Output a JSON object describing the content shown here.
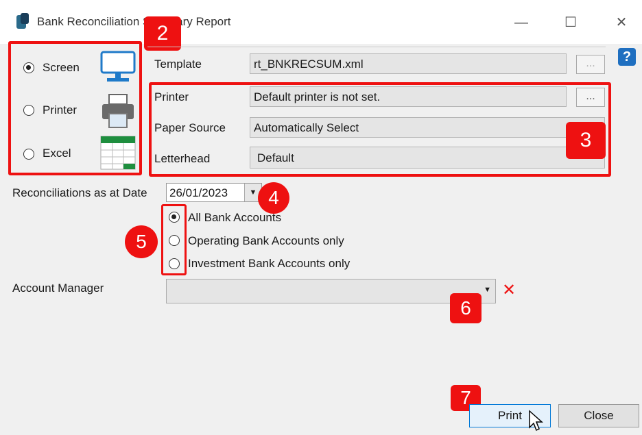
{
  "window": {
    "title": "Bank Reconciliation Summary Report",
    "minimize": "—",
    "maximize": "☐",
    "close": "✕"
  },
  "output": {
    "options": [
      "Screen",
      "Printer",
      "Excel"
    ],
    "selected": "Screen"
  },
  "settings": {
    "template_label": "Template",
    "template_value": "rt_BNKRECSUM.xml",
    "printer_label": "Printer",
    "printer_value": "Default printer is not set.",
    "paper_label": "Paper Source",
    "paper_value": "Automatically Select",
    "letterhead_label": "Letterhead",
    "letterhead_value": "Default",
    "browse": "..."
  },
  "date": {
    "label": "Reconciliations as at Date",
    "value": "26/01/2023"
  },
  "accounts": {
    "options": [
      "All Bank Accounts",
      "Operating Bank Accounts only",
      "Investment Bank Accounts only"
    ],
    "selected": "All Bank Accounts"
  },
  "manager": {
    "label": "Account Manager",
    "value": ""
  },
  "buttons": {
    "print": "Print",
    "close": "Close",
    "help": "?"
  },
  "badges": [
    "2",
    "3",
    "4",
    "5",
    "6",
    "7"
  ],
  "colors": {
    "highlight": "#e11111",
    "accent": "#1f7ac9",
    "excel_green": "#1e8e3e"
  }
}
